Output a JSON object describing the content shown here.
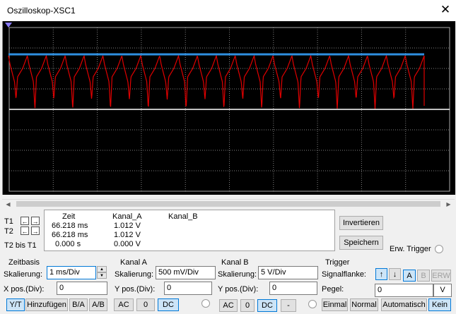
{
  "window": {
    "title": "Oszilloskop-XSC1",
    "close_symbol": "✕"
  },
  "readout": {
    "rows": [
      {
        "label": "T1",
        "zeit": "66.218 ms",
        "kanal_a": "1.012 V",
        "kanal_b": ""
      },
      {
        "label": "T2",
        "zeit": "66.218 ms",
        "kanal_a": "1.012 V",
        "kanal_b": ""
      },
      {
        "label": "T2 bis T1",
        "zeit": "0.000 s",
        "kanal_a": "0.000 V",
        "kanal_b": ""
      }
    ],
    "headers": {
      "zeit": "Zeit",
      "kanal_a": "Kanal_A",
      "kanal_b": "Kanal_B"
    },
    "arrow_left": "←",
    "arrow_right": "→"
  },
  "side_buttons": {
    "invert": "Invertieren",
    "save": "Speichern",
    "ext_trigger": "Erw. Trigger"
  },
  "zeitbasis": {
    "title": "Zeitbasis",
    "scale_label": "Skalierung:",
    "scale_value": "1 ms/Div",
    "xpos_label": "X pos.(Div):",
    "xpos_value": "0",
    "modes": [
      "Y/T",
      "Hinzufügen",
      "B/A",
      "A/B"
    ],
    "active_mode": "Y/T"
  },
  "kanal_a": {
    "title": "Kanal A",
    "scale_label": "Skalierung:",
    "scale_value": "500 mV/Div",
    "ypos_label": "Y pos.(Div):",
    "ypos_value": "0",
    "coupling": [
      "AC",
      "0",
      "DC"
    ],
    "active": "DC"
  },
  "kanal_b": {
    "title": "Kanal B",
    "scale_label": "Skalierung:",
    "scale_value": "5  V/Div",
    "ypos_label": "Y pos.(Div):",
    "ypos_value": "0",
    "coupling": [
      "AC",
      "0",
      "DC",
      "-"
    ],
    "active": "DC"
  },
  "trigger": {
    "title": "Trigger",
    "edge_label": "Signalflanke:",
    "edge_rising": "↑",
    "edge_falling": "↓",
    "sources": [
      "A",
      "B",
      "ERW"
    ],
    "active_source": "A",
    "level_label": "Pegel:",
    "level_value": "0",
    "level_unit": "V",
    "modes": [
      "Einmal",
      "Normal",
      "Automatisch",
      "Kein"
    ],
    "active_mode": "Kein"
  },
  "colors": {
    "screen_bg": "#000000",
    "grid": "#808080",
    "channel_a": "#e00000",
    "channel_b_cursor": "#2e8fe0",
    "baseline": "#ffffff",
    "selected": "#cce4f7"
  }
}
